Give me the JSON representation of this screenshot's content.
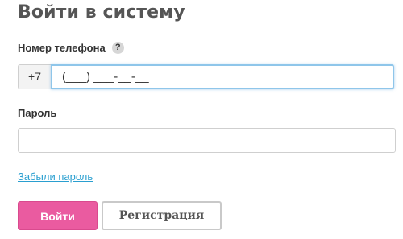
{
  "page": {
    "title": "Войти в систему"
  },
  "phone": {
    "label": "Номер телефона",
    "help": "?",
    "prefix": "+7",
    "value": "(___) ___-__-__"
  },
  "password": {
    "label": "Пароль",
    "value": ""
  },
  "links": {
    "forgot": "Забыли пароль"
  },
  "buttons": {
    "login": "Войти",
    "register": "Регистрация"
  },
  "colors": {
    "accent": "#ea5ba0",
    "link": "#2a9fd0",
    "focus_border": "#8fc6ea"
  }
}
